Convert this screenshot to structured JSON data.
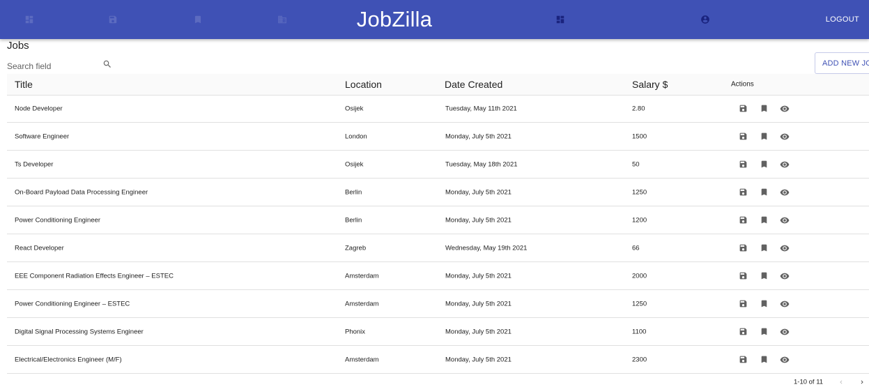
{
  "appbar": {
    "brand": "JobZilla",
    "logout_label": "LOGOUT",
    "nav_icons": [
      "dashboard-icon",
      "save-icon",
      "bookmark-icon",
      "business-icon",
      "dashboard-icon",
      "account-circle-icon"
    ]
  },
  "page": {
    "title": "Jobs",
    "search_placeholder": "Search field",
    "add_button": "ADD NEW JOB"
  },
  "table": {
    "columns": {
      "title": "Title",
      "location": "Location",
      "date": "Date Created",
      "salary": "Salary $",
      "actions": "Actions"
    },
    "rows": [
      {
        "title": "Node Developer",
        "location": "Osijek",
        "date": "Tuesday, May 11th 2021",
        "salary": "2.80"
      },
      {
        "title": "Software Engineer",
        "location": "London",
        "date": "Monday, July 5th 2021",
        "salary": "1500"
      },
      {
        "title": "Ts Developer",
        "location": "Osijek",
        "date": "Tuesday, May 18th 2021",
        "salary": "50"
      },
      {
        "title": "On-Board Payload Data Processing Engineer",
        "location": "Berlin",
        "date": "Monday, July 5th 2021",
        "salary": "1250"
      },
      {
        "title": "Power Conditioning Engineer",
        "location": "Berlin",
        "date": "Monday, July 5th 2021",
        "salary": "1200"
      },
      {
        "title": "React Developer",
        "location": "Zagreb",
        "date": "Wednesday, May 19th 2021",
        "salary": "66"
      },
      {
        "title": "EEE Component Radiation Effects Engineer – ESTEC",
        "location": "Amsterdam",
        "date": "Monday, July 5th 2021",
        "salary": "2000"
      },
      {
        "title": "Power Conditioning Engineer – ESTEC",
        "location": "Amsterdam",
        "date": "Monday, July 5th 2021",
        "salary": "1250"
      },
      {
        "title": "Digital Signal Processing Systems Engineer",
        "location": "Phonix",
        "date": "Monday, July 5th 2021",
        "salary": "1100"
      },
      {
        "title": "Electrical/Electronics Engineer (M/F)",
        "location": "Amsterdam",
        "date": "Monday, July 5th 2021",
        "salary": "2300"
      }
    ],
    "row_action_icons": [
      "save-icon",
      "bookmark-icon",
      "visibility-icon"
    ]
  },
  "pagination": {
    "range": "1-10 of 11"
  },
  "colors": {
    "primary": "#3f51b5",
    "icon_gray": "#616161"
  }
}
